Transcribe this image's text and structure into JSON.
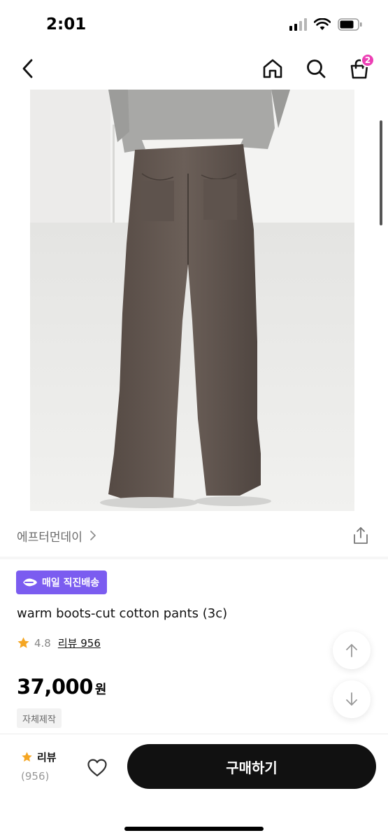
{
  "status_bar": {
    "time": "2:01"
  },
  "nav": {
    "cart_count": "2",
    "icons": [
      "chevron-left-icon",
      "home-icon",
      "search-icon",
      "shopping-bag-icon"
    ]
  },
  "product": {
    "brand": "에프터먼데이",
    "delivery_badge": "매일 직진배송",
    "name": "warm boots-cut cotton pants (3c)",
    "rating": "4.8",
    "review_link": "리뷰 956",
    "price": "37,000",
    "price_unit": "원",
    "tag": "자체제작"
  },
  "bottom_bar": {
    "review_label": "리뷰",
    "review_count": "(956)",
    "buy_label": "구매하기"
  },
  "colors": {
    "accent_purple": "#7b5cf0",
    "badge_pink": "#ec3fb4",
    "star_orange": "#f5a623",
    "buy_button": "#111111"
  }
}
